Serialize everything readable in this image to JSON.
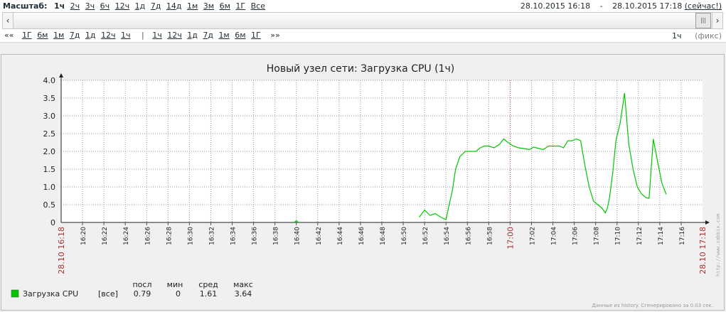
{
  "nav": {
    "zoom_label": "Масштаб:",
    "periods": [
      {
        "label": "1ч",
        "active": true
      },
      {
        "label": "2ч",
        "active": false
      },
      {
        "label": "3ч",
        "active": false
      },
      {
        "label": "6ч",
        "active": false
      },
      {
        "label": "12ч",
        "active": false
      },
      {
        "label": "1д",
        "active": false
      },
      {
        "label": "7д",
        "active": false
      },
      {
        "label": "14д",
        "active": false
      },
      {
        "label": "1м",
        "active": false
      },
      {
        "label": "3м",
        "active": false
      },
      {
        "label": "6м",
        "active": false
      },
      {
        "label": "1Г",
        "active": false
      },
      {
        "label": "Все",
        "active": false
      }
    ],
    "date_from": "28.10.2015 16:18",
    "sep": "-",
    "date_to": "28.10.2015 17:18",
    "now_label": "(сейчас!)",
    "scroll_left": "‹",
    "scroll_right": "›",
    "back_marker": "««",
    "back_links": [
      "1Г",
      "6м",
      "1м",
      "7д",
      "1д",
      "12ч",
      "1ч"
    ],
    "divider": "|",
    "fwd_links": [
      "1ч",
      "12ч",
      "1д",
      "7д",
      "1м",
      "6м",
      "1Г"
    ],
    "fwd_marker": "»»",
    "period_value": "1ч",
    "fixed_label": "(фикс)"
  },
  "graph": {
    "side_text": "http://www.zabbix.com",
    "footer_text": "Данные из history. Сгенерировано за 0.03 сек."
  },
  "chart_data": {
    "type": "line",
    "title": "Новый узел сети: Загрузка CPU (1ч)",
    "ylim": [
      0,
      4.0
    ],
    "yticks": [
      "0",
      "0.5",
      "1.0",
      "1.5",
      "2.0",
      "2.5",
      "3.0",
      "3.5",
      "4.0"
    ],
    "x_start_label": "28.10 16:18",
    "x_end_label": "28.10 17:18",
    "x_start_minutes": 0,
    "x_end_minutes": 60,
    "xtick_labels": [
      "16:20",
      "16:22",
      "16:24",
      "16:26",
      "16:28",
      "16:30",
      "16:32",
      "16:34",
      "16:36",
      "16:38",
      "16:40",
      "16:42",
      "16:44",
      "16:46",
      "16:48",
      "16:50",
      "16:52",
      "16:54",
      "16:56",
      "16:58",
      "17:00",
      "17:02",
      "17:04",
      "17:06",
      "17:08",
      "17:10",
      "17:12",
      "17:14",
      "17:16"
    ],
    "highlight_label": "17:00",
    "grid": true,
    "colors": {
      "series": "#00c800",
      "highlight": "#a83232",
      "grid": "#999999"
    },
    "series": [
      {
        "name": "Загрузка CPU",
        "range": "[все]",
        "last": "0.79",
        "min": "0",
        "avg": "1.61",
        "max": "3.64",
        "segments": [
          [
            [
              21.8,
              0
            ],
            [
              22.0,
              0.05
            ],
            [
              22.2,
              0
            ]
          ],
          [
            [
              33.5,
              0.15
            ],
            [
              34.0,
              0.35
            ],
            [
              34.5,
              0.2
            ],
            [
              35.0,
              0.25
            ],
            [
              35.5,
              0.15
            ],
            [
              36.0,
              0.08
            ],
            [
              36.3,
              0.5
            ],
            [
              36.6,
              0.9
            ],
            [
              36.9,
              1.5
            ],
            [
              37.3,
              1.85
            ],
            [
              37.8,
              2.0
            ],
            [
              38.3,
              2.0
            ],
            [
              38.8,
              2.0
            ],
            [
              39.2,
              2.1
            ],
            [
              39.6,
              2.15
            ],
            [
              40.0,
              2.15
            ],
            [
              40.5,
              2.1
            ],
            [
              41.0,
              2.2
            ],
            [
              41.4,
              2.35
            ],
            [
              41.8,
              2.25
            ],
            [
              42.3,
              2.15
            ],
            [
              42.8,
              2.1
            ],
            [
              43.3,
              2.08
            ],
            [
              43.8,
              2.05
            ],
            [
              44.2,
              2.12
            ],
            [
              44.7,
              2.08
            ],
            [
              45.1,
              2.05
            ],
            [
              45.6,
              2.15
            ],
            [
              46.1,
              2.15
            ],
            [
              46.6,
              2.15
            ],
            [
              47.0,
              2.1
            ],
            [
              47.4,
              2.3
            ],
            [
              47.8,
              2.3
            ],
            [
              48.2,
              2.35
            ],
            [
              48.6,
              2.3
            ],
            [
              49.0,
              1.6
            ],
            [
              49.4,
              1.0
            ],
            [
              49.8,
              0.6
            ],
            [
              50.2,
              0.5
            ],
            [
              50.6,
              0.4
            ],
            [
              50.9,
              0.27
            ],
            [
              51.1,
              0.4
            ],
            [
              51.3,
              0.7
            ],
            [
              51.6,
              1.4
            ],
            [
              51.9,
              2.3
            ],
            [
              52.3,
              2.8
            ],
            [
              52.7,
              3.64
            ],
            [
              53.1,
              2.2
            ],
            [
              53.5,
              1.5
            ],
            [
              53.9,
              1.0
            ],
            [
              54.3,
              0.8
            ],
            [
              54.7,
              0.7
            ],
            [
              55.0,
              0.68
            ],
            [
              55.4,
              2.35
            ],
            [
              55.8,
              1.7
            ],
            [
              56.2,
              1.1
            ],
            [
              56.6,
              0.79
            ]
          ]
        ]
      }
    ]
  }
}
